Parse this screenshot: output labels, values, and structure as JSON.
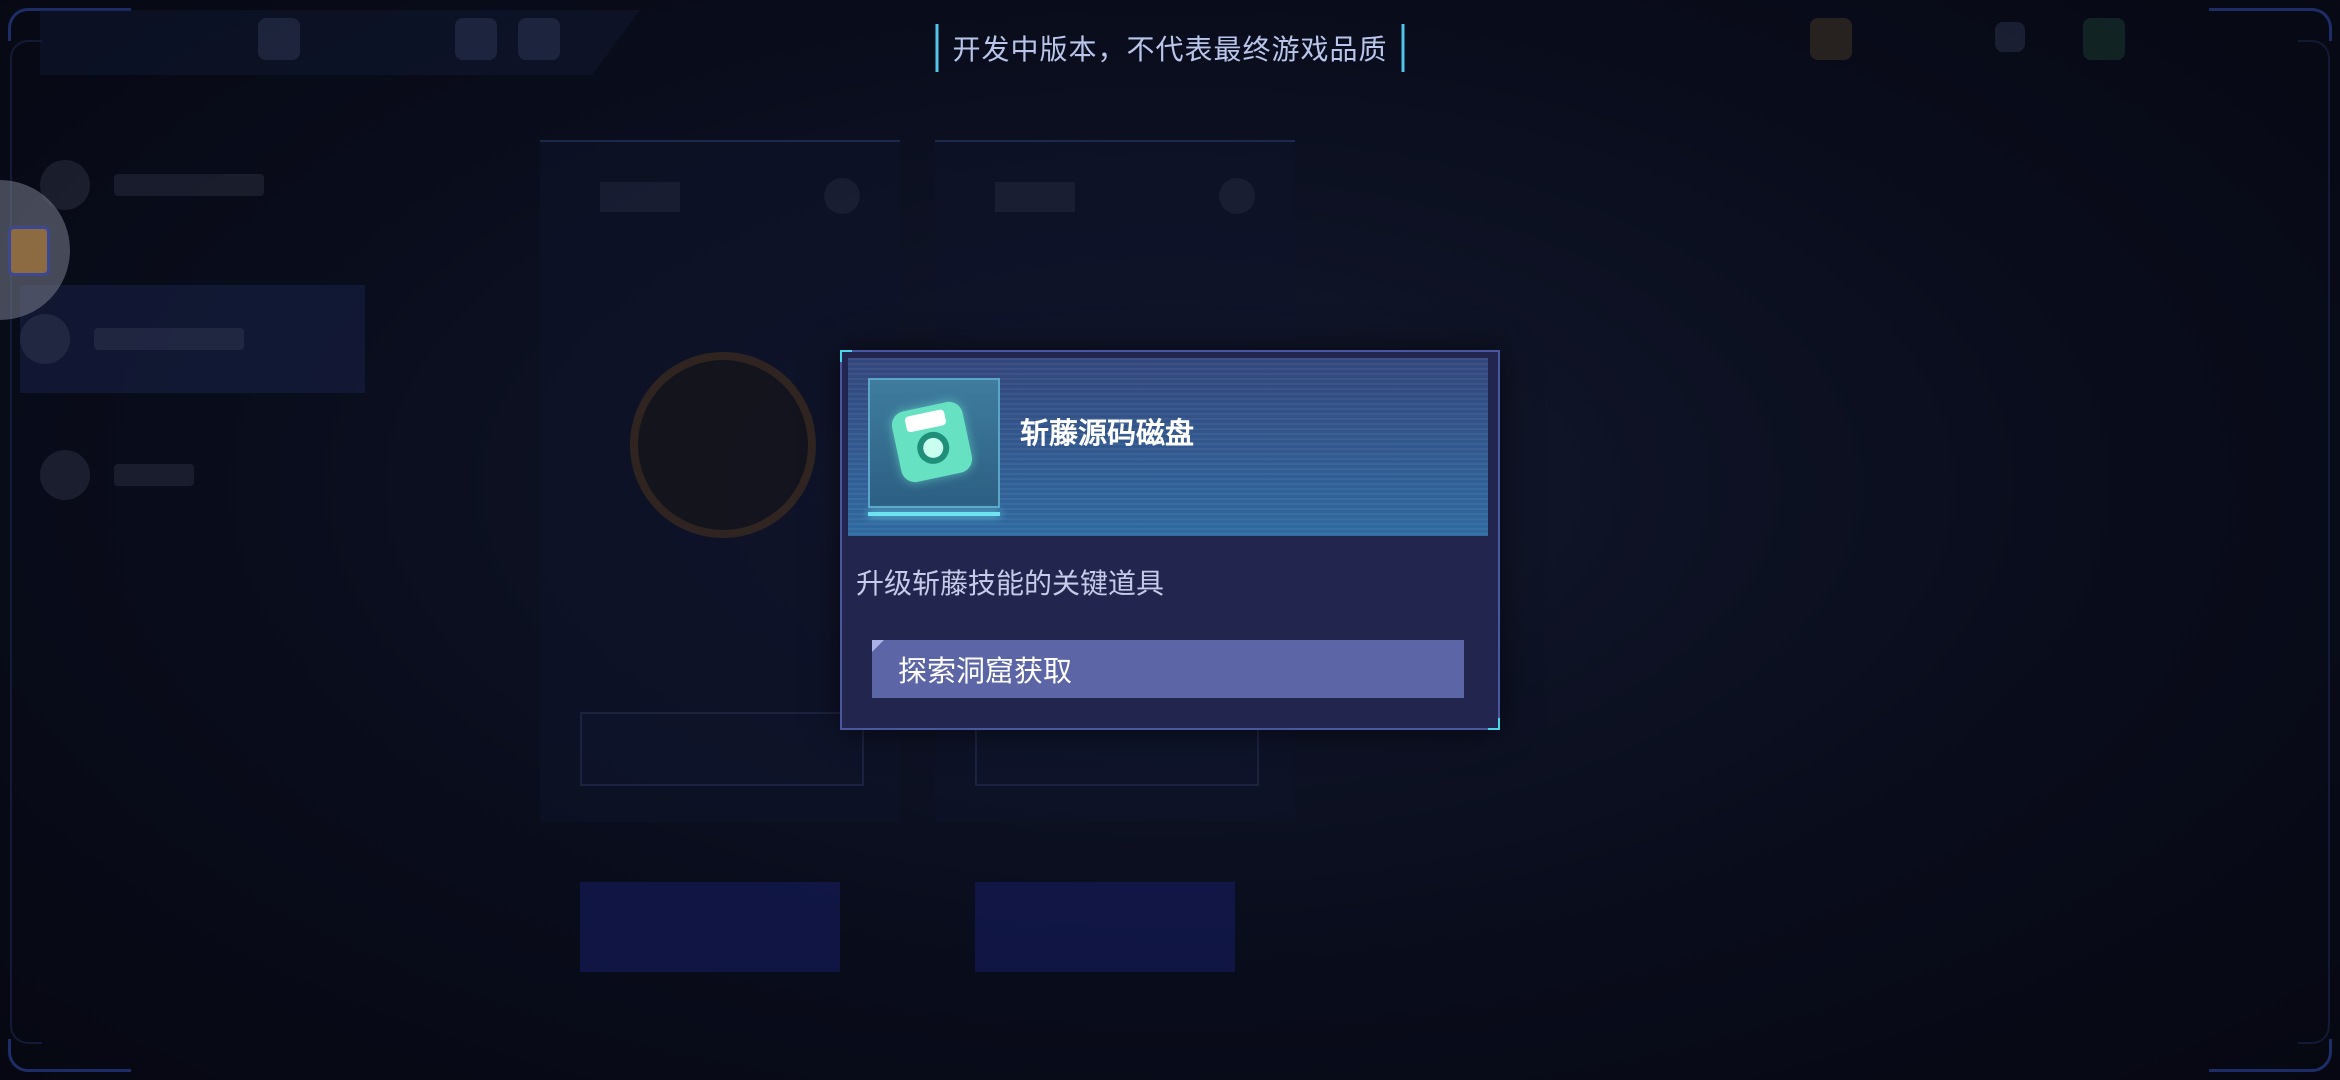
{
  "watermark": "开发中版本，不代表最终游戏品质",
  "item_popup": {
    "name": "斩藤源码磁盘",
    "description": "升级斩藤技能的关键道具",
    "source_button": "探索洞窟获取",
    "icon": "floppy-disk-icon"
  },
  "colors": {
    "popup_bg": "#22264e",
    "header_bg": "#2f6aa0",
    "button_bg": "#5c65a6",
    "accent": "#4cd3e8"
  }
}
